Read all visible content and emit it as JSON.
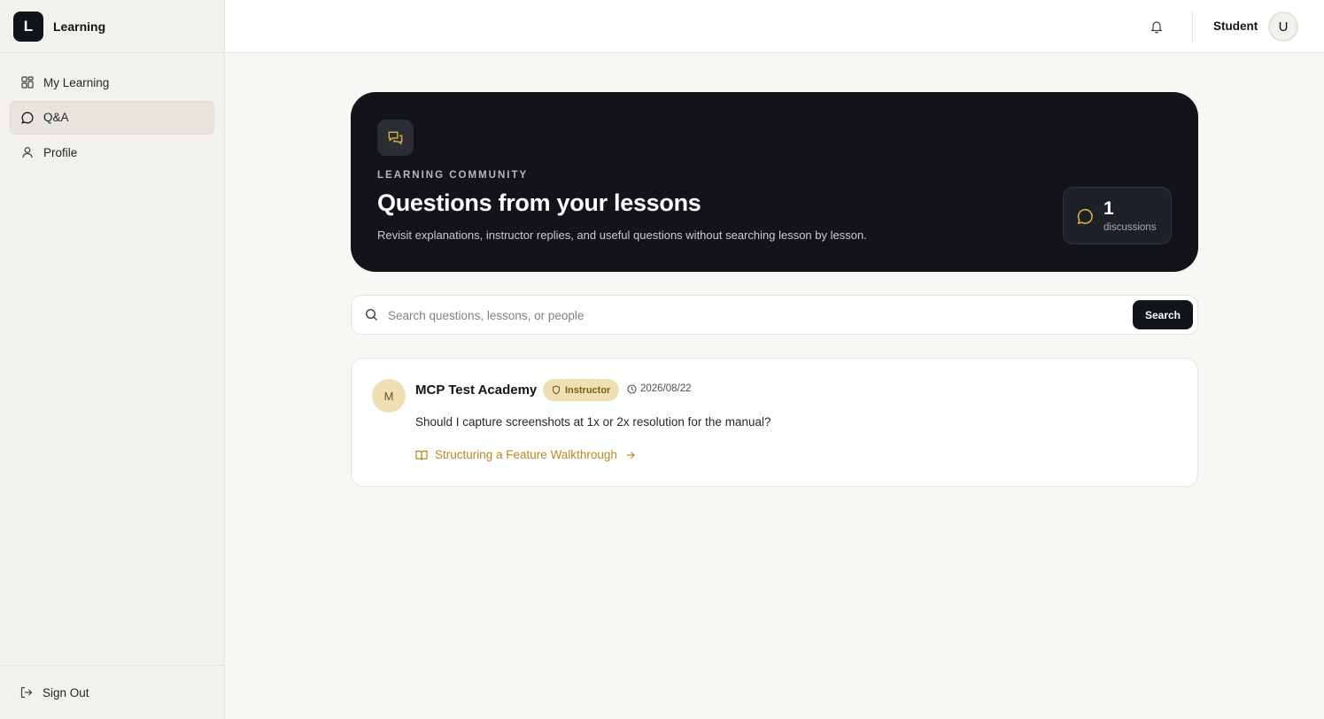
{
  "brand": {
    "logo_letter": "L",
    "name": "Learning"
  },
  "sidebar": {
    "items": [
      {
        "label": "My Learning",
        "icon": "grid-icon",
        "active": false
      },
      {
        "label": "Q&A",
        "icon": "chat-bubble-icon",
        "active": true
      },
      {
        "label": "Profile",
        "icon": "user-icon",
        "active": false
      }
    ],
    "sign_out_label": "Sign Out"
  },
  "topbar": {
    "user_name": "Student",
    "avatar_letter": "U"
  },
  "hero": {
    "eyebrow": "LEARNING COMMUNITY",
    "title": "Questions from your lessons",
    "subtitle": "Revisit explanations, instructor replies, and useful questions without searching lesson by lesson.",
    "stat_count": "1",
    "stat_label": "discussions"
  },
  "search": {
    "placeholder": "Search questions, lessons, or people",
    "value": "",
    "button_label": "Search"
  },
  "discussions": [
    {
      "avatar_letter": "M",
      "author": "MCP Test Academy",
      "role_badge": "Instructor",
      "date": "2026/08/22",
      "question": "Should I capture screenshots at 1x or 2x resolution for the manual?",
      "lesson": "Structuring a Feature Walkthrough"
    }
  ],
  "colors": {
    "accent": "#b88a1c",
    "dark": "#121419",
    "badge_bg": "#efe0b4"
  }
}
